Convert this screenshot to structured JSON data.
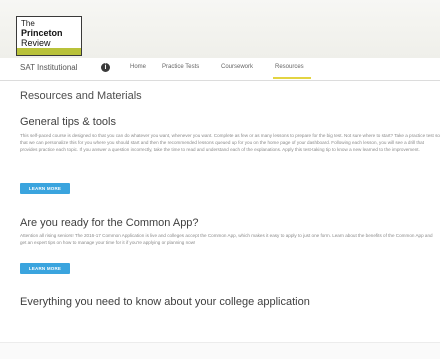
{
  "brand": {
    "line1": "The",
    "line2": "Princeton",
    "line3": "Review"
  },
  "nav": {
    "title": "SAT Institutional",
    "info_symbol": "i",
    "links": [
      "Home",
      "Practice Tests",
      "Coursework",
      "Resources"
    ],
    "active": "Resources"
  },
  "page": {
    "title": "Resources and Materials"
  },
  "sections": [
    {
      "title": "General tips & tools",
      "body": "This self-paced course is designed so that you can do whatever you want, whenever you want. Complete as few or as many lessons to prepare for the big test. Not sure where to start? Take a practice test so that we can personalize this for you where you should start and then the recommended lessons queued up for you on the home page of your dashboard. Following each lesson, you will see a drill that provides practice each topic. If you answer a question incorrectly, take the time to read and understand each of the explanations. Apply this test-taking tip to know a new learned to the improvement.",
      "button": "LEARN MORE"
    },
    {
      "title": "Are you ready for the Common App?",
      "body": "Attention all rising seniors! The 2016-17 Common Application is live and colleges accept the Common App, which makes it easy to apply to just one form. Learn about the benefits of the Common App and get an expert tips on how to manage your time for it if you're applying or planning now!",
      "button": "LEARN MORE"
    },
    {
      "title": "Everything you need to know about your college application"
    }
  ]
}
